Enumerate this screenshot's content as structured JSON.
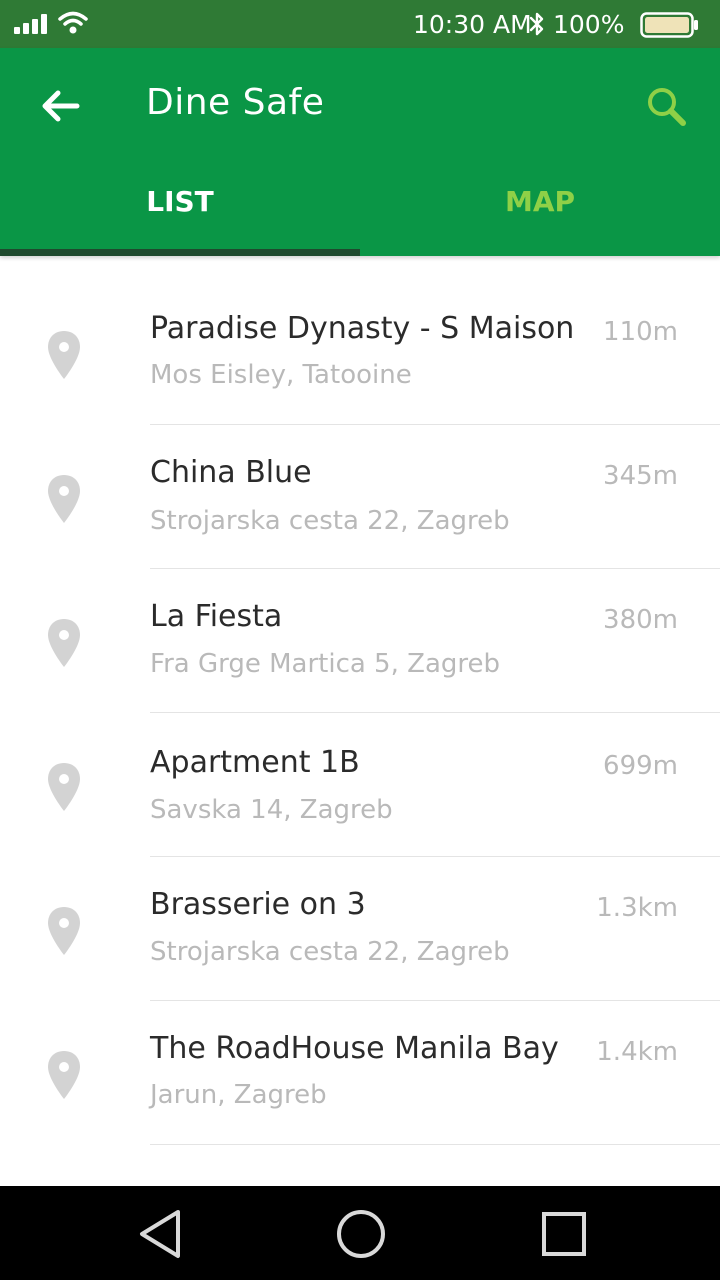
{
  "status_bar": {
    "time": "10:30 AM",
    "battery_text": "100%",
    "icons": [
      "signal-icon",
      "wifi-icon",
      "bluetooth-icon",
      "battery-icon"
    ]
  },
  "app_bar": {
    "title": "Dine Safe",
    "back_icon": "arrow-left-icon",
    "search_icon": "search-icon",
    "colors": {
      "background": "#0a9646",
      "status_bar": "#2f7a35",
      "accent": "#8fd047",
      "indicator": "#1f4a2e"
    }
  },
  "tabs": [
    {
      "label": "LIST",
      "active": true
    },
    {
      "label": "MAP",
      "active": false
    }
  ],
  "restaurants": [
    {
      "name": "Paradise Dynasty - S Maison",
      "address": "Mos Eisley, Tatooine",
      "distance": "110m"
    },
    {
      "name": "China Blue",
      "address": "Strojarska cesta 22, Zagreb",
      "distance": "345m"
    },
    {
      "name": "La Fiesta",
      "address": "Fra Grge Martica 5, Zagreb",
      "distance": "380m"
    },
    {
      "name": "Apartment 1B",
      "address": "Savska 14, Zagreb",
      "distance": "699m"
    },
    {
      "name": "Brasserie on 3",
      "address": "Strojarska cesta 22, Zagreb",
      "distance": "1.3km"
    },
    {
      "name": "The RoadHouse Manila Bay",
      "address": "Jarun, Zagreb",
      "distance": "1.4km"
    }
  ],
  "nav_bar": {
    "icons": [
      "back-triangle-icon",
      "home-circle-icon",
      "recents-square-icon"
    ]
  }
}
